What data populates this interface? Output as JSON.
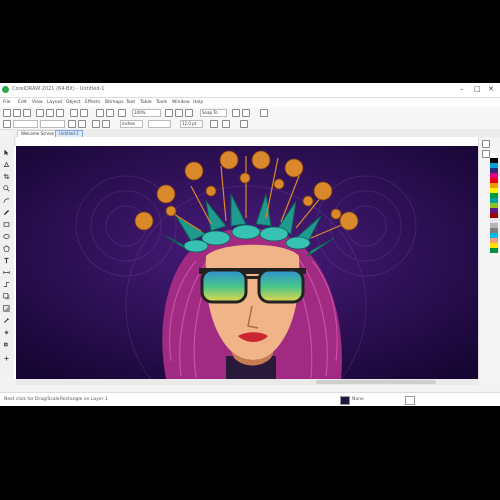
{
  "app": {
    "title": "CorelDRAW 2021 (64-Bit) - Untitled-1",
    "window_controls": [
      "–",
      "□",
      "✕"
    ]
  },
  "menu": [
    "File",
    "Edit",
    "View",
    "Layout",
    "Object",
    "Effects",
    "Bitmaps",
    "Text",
    "Table",
    "Tools",
    "Window",
    "Help"
  ],
  "toolbar": {
    "font_size": "12.0 pt",
    "unit": "inches",
    "zoom": "100%",
    "snap_to": "Snap To"
  },
  "tabs": [
    {
      "label": "Welcome Screen",
      "active": false
    },
    {
      "label": "Untitled-1",
      "active": true
    }
  ],
  "left_tools": [
    "pick-tool",
    "shape-tool",
    "crop-tool",
    "zoom-tool",
    "freehand-tool",
    "artistic-media-tool",
    "rectangle-tool",
    "ellipse-tool",
    "polygon-tool",
    "text-tool",
    "parallel-dimension-tool",
    "connector-tool",
    "drop-shadow-tool",
    "transparency-tool",
    "color-eyedropper-tool",
    "interactive-fill-tool",
    "smart-fill-tool"
  ],
  "page_nav": {
    "page_label": "Page 1"
  },
  "status": {
    "left": "Next click for Drag/Scale",
    "middle": "Rectangle on Layer 1",
    "fill": "None"
  },
  "palette_colors": [
    "#ffffff",
    "#000000",
    "#00a0e3",
    "#2b2a84",
    "#e4007f",
    "#e60012",
    "#f39800",
    "#fff100",
    "#009944",
    "#00a29a",
    "#8fc31f",
    "#601986",
    "#a40000",
    "#e5e5e5",
    "#b5b5b5",
    "#7d7d7d",
    "#00b7ee",
    "#f29b76",
    "#ffe100",
    "#00913a"
  ],
  "artwork": {
    "background_color": "#2e0f57",
    "hair_color": "#a12a82",
    "crown_leaf_color": "#1f9a8f",
    "flower_color": "#d9882a",
    "skin_color": "#f0b488",
    "lens_color": "#3fb98f"
  }
}
